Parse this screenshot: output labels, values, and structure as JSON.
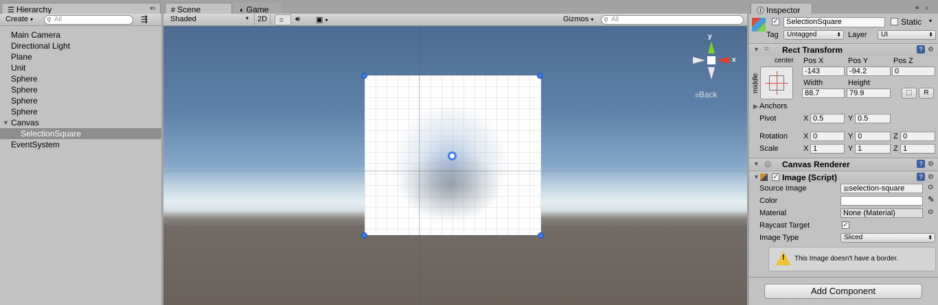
{
  "hierarchy": {
    "tab_label": "Hierarchy",
    "create_label": "Create",
    "search_placeholder": "All",
    "items": [
      {
        "label": "Main Camera"
      },
      {
        "label": "Directional Light"
      },
      {
        "label": "Plane"
      },
      {
        "label": "Unit"
      },
      {
        "label": "Sphere"
      },
      {
        "label": "Sphere"
      },
      {
        "label": "Sphere"
      },
      {
        "label": "Sphere"
      },
      {
        "label": "Canvas"
      },
      {
        "label": "SelectionSquare"
      },
      {
        "label": "EventSystem"
      }
    ]
  },
  "scene": {
    "tabs": [
      {
        "label": "Scene"
      },
      {
        "label": "Game"
      }
    ],
    "shading_mode": "Shaded",
    "mode_2d_label": "2D",
    "gizmos_label": "Gizmos",
    "search_placeholder": "All",
    "gizmo_axes": {
      "y": "y",
      "x": "x"
    },
    "view_label": "Back"
  },
  "inspector": {
    "tab_label": "Inspector",
    "object_name": "SelectionSquare",
    "static_label": "Static",
    "tag_label": "Tag",
    "tag_value": "Untagged",
    "layer_label": "Layer",
    "layer_value": "UI",
    "rect_transform": {
      "title": "Rect Transform",
      "anchor_h": "center",
      "anchor_v": "middle",
      "pos_x_label": "Pos X",
      "pos_x": "-143",
      "pos_y_label": "Pos Y",
      "pos_y": "-94.2",
      "pos_z_label": "Pos Z",
      "pos_z": "0",
      "width_label": "Width",
      "width": "88.7",
      "height_label": "Height",
      "height": "79.9",
      "r_button": "R",
      "anchors_label": "Anchors",
      "pivot_label": "Pivot",
      "pivot_x": "0.5",
      "pivot_y": "0.5",
      "rotation_label": "Rotation",
      "rot_x": "0",
      "rot_y": "0",
      "rot_z": "0",
      "scale_label": "Scale",
      "scale_x": "1",
      "scale_y": "1",
      "scale_z": "1",
      "x_axis": "X",
      "y_axis": "Y",
      "z_axis": "Z"
    },
    "canvas_renderer": {
      "title": "Canvas Renderer"
    },
    "image_script": {
      "title": "Image (Script)",
      "source_image_label": "Source Image",
      "source_image_value": "selection-square",
      "color_label": "Color",
      "material_label": "Material",
      "material_value": "None (Material)",
      "raycast_label": "Raycast Target",
      "image_type_label": "Image Type",
      "image_type_value": "Sliced",
      "warning_text": "This Image doesn't have a border."
    },
    "add_component_label": "Add Component"
  },
  "colors": {
    "selection_bg": "#8e8e8e",
    "handle_blue": "#3c7be0",
    "axis_x_red": "#e0402a",
    "axis_y_green": "#7ed12e"
  }
}
